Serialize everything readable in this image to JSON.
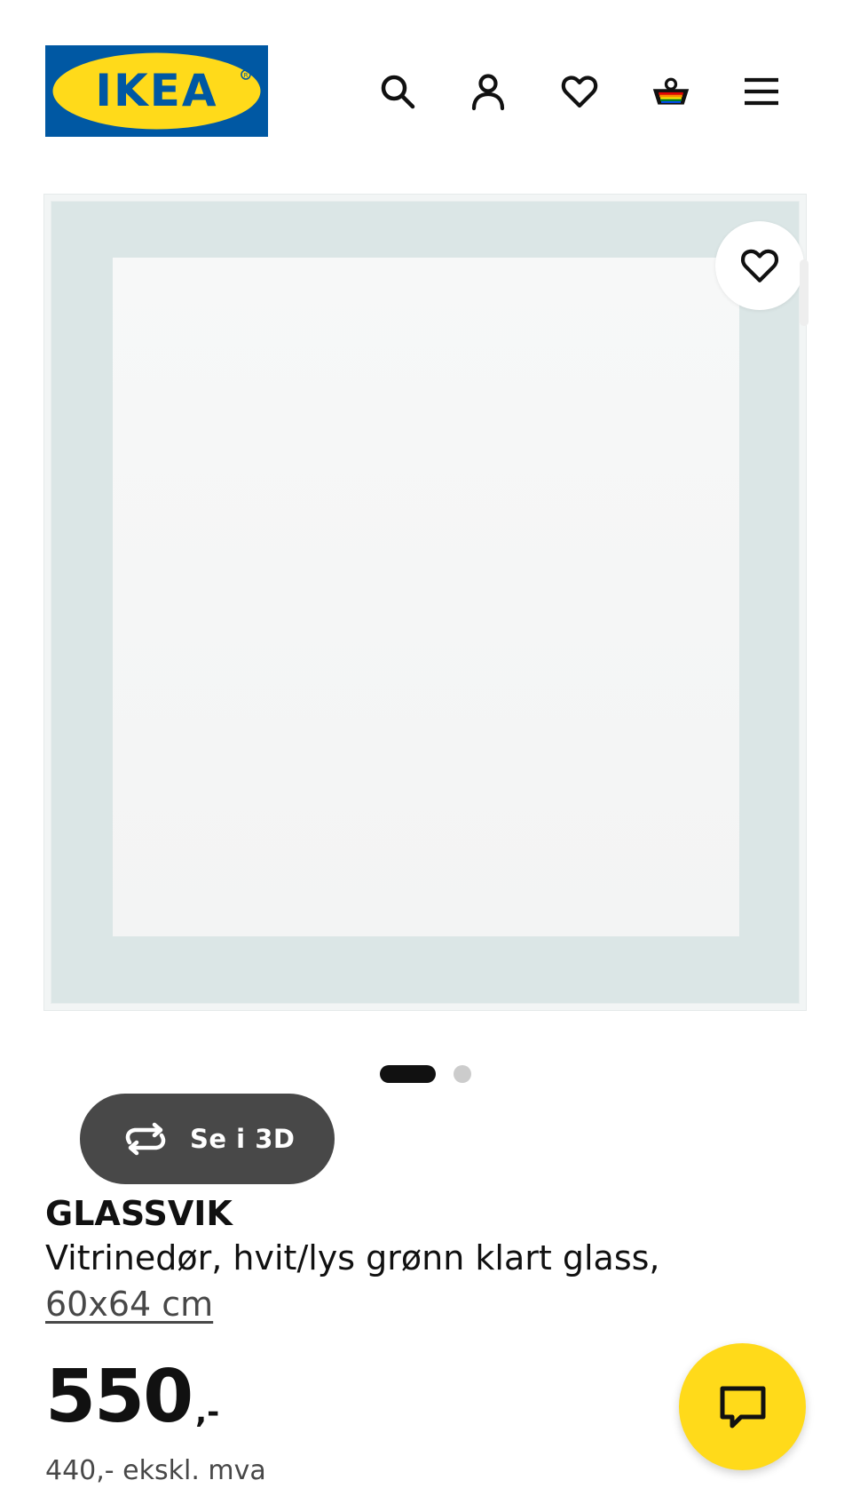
{
  "header": {
    "logo_text": "IKEA",
    "icons": [
      "search-icon",
      "user-icon",
      "heart-icon",
      "basket-icon",
      "menu-icon"
    ]
  },
  "gallery": {
    "view_3d_label": "Se i 3D",
    "slide_count": 2,
    "active_slide": 1
  },
  "product": {
    "name": "GLASSVIK",
    "description": "Vitrinedør, hvit/lys grønn klart glass,",
    "size": "60x64 cm",
    "price": "550",
    "price_suffix": ",-",
    "price_ex_vat": "440,- ekskl. mva"
  },
  "colors": {
    "brand_blue": "#0058A3",
    "brand_yellow": "#FFDA1A",
    "text": "#111111",
    "muted_text": "#484848"
  }
}
